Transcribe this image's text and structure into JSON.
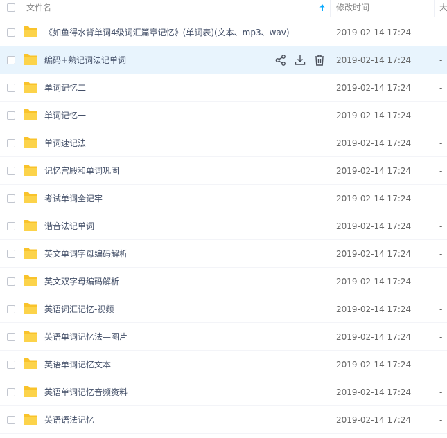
{
  "header": {
    "name_col": "文件名",
    "time_col": "修改时间",
    "size_col": "大"
  },
  "rows": [
    {
      "name": "《如鱼得水背单词4级词汇篇章记忆》(单词表)(文本、mp3、wav)",
      "time": "2019-02-14 17:24",
      "size": "-"
    },
    {
      "name": "编码+熟记词法记单词",
      "time": "2019-02-14 17:24",
      "size": "-"
    },
    {
      "name": "单词记忆二",
      "time": "2019-02-14 17:24",
      "size": "-"
    },
    {
      "name": "单词记忆一",
      "time": "2019-02-14 17:24",
      "size": "-"
    },
    {
      "name": "单词速记法",
      "time": "2019-02-14 17:24",
      "size": "-"
    },
    {
      "name": "记忆宫殿和单词巩固",
      "time": "2019-02-14 17:24",
      "size": "-"
    },
    {
      "name": "考试单词全记牢",
      "time": "2019-02-14 17:24",
      "size": "-"
    },
    {
      "name": "谐音法记单词",
      "time": "2019-02-14 17:24",
      "size": "-"
    },
    {
      "name": "英文单词字母编码解析",
      "time": "2019-02-14 17:24",
      "size": "-"
    },
    {
      "name": "英文双字母编码解析",
      "time": "2019-02-14 17:24",
      "size": "-"
    },
    {
      "name": "英语词汇记忆-视频",
      "time": "2019-02-14 17:24",
      "size": "-"
    },
    {
      "name": "英语单词记忆法—图片",
      "time": "2019-02-14 17:24",
      "size": "-"
    },
    {
      "name": "英语单词记忆文本",
      "time": "2019-02-14 17:24",
      "size": "-"
    },
    {
      "name": "英语单词记忆音频资料",
      "time": "2019-02-14 17:24",
      "size": "-"
    },
    {
      "name": "英语语法记忆",
      "time": "2019-02-14 17:24",
      "size": "-"
    }
  ],
  "selected_row": 1,
  "icons": {
    "row_icon": "folder-icon",
    "actions": [
      "share-icon",
      "download-icon",
      "delete-icon"
    ],
    "sort": "sort-ascending-icon"
  },
  "colors": {
    "folder": "#f9c32b",
    "accent": "#09aaff",
    "selected_row_bg": "#e8f4fd"
  }
}
